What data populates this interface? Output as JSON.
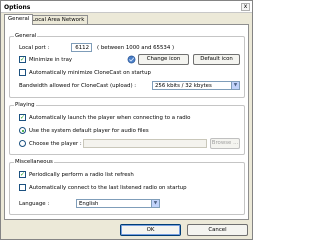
{
  "window": {
    "title": "Options",
    "close_glyph": "x"
  },
  "tabs": [
    {
      "label": "General",
      "active": true
    },
    {
      "label": "Local Area Network",
      "active": false
    }
  ],
  "general": {
    "group_label": "General",
    "local_port_label": "Local port :",
    "local_port_value": "6112",
    "port_range_note": "( between 1000 and 65534 )",
    "minimize_in_tray": {
      "label": "Minimize in tray",
      "checked": true
    },
    "change_icon_label": "Change icon",
    "default_icon_label": "Default icon",
    "auto_minimize": {
      "label": "Automatically minimize CloneCast on startup",
      "checked": false
    },
    "bandwidth_label": "Bandwidth allowed for CloneCast (upload) :",
    "bandwidth_value": "256 kbits / 32 kbytes",
    "tray_icon_name": "clonecast-tray-icon"
  },
  "playing": {
    "group_label": "Playing",
    "auto_launch": {
      "label": "Automatically launch the player when connecting to a radio",
      "checked": true
    },
    "use_system_player": {
      "label": "Use the system default player for audio files",
      "selected": true
    },
    "choose_player": {
      "label": "Choose the player :",
      "selected": false,
      "value": ""
    },
    "browse_label": "Browse ..."
  },
  "misc": {
    "group_label": "Miscellaneous",
    "periodic_refresh": {
      "label": "Periodically perform a radio list refresh",
      "checked": true
    },
    "auto_connect": {
      "label": "Automatically connect to the last listened radio on startup",
      "checked": false
    },
    "language_label": "Language :",
    "language_value": "English"
  },
  "footer": {
    "ok_label": "OK",
    "cancel_label": "Cancel"
  },
  "colors": {
    "check_green": "#21a121",
    "tab_panel": "#ffffff",
    "dialog_bg": "#ece9d8"
  }
}
